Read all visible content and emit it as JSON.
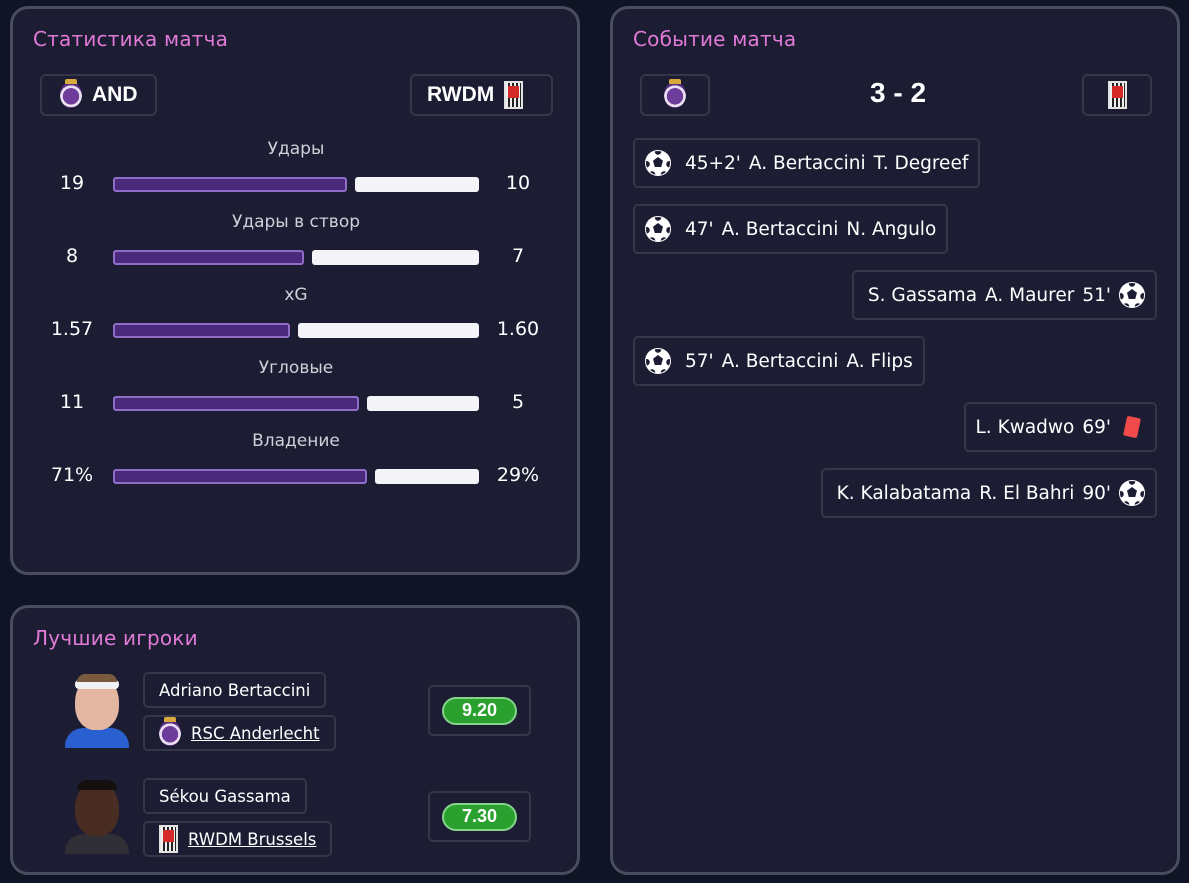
{
  "stats_panel": {
    "title": "Статистика матча",
    "home_team": "AND",
    "away_team": "RWDM",
    "stats": [
      {
        "label": "Удары",
        "home": "19",
        "away": "10",
        "home_share": 0.655
      },
      {
        "label": "Удары в створ",
        "home": "8",
        "away": "7",
        "home_share": 0.533
      },
      {
        "label": "xG",
        "home": "1.57",
        "away": "1.60",
        "home_share": 0.495
      },
      {
        "label": "Угловые",
        "home": "11",
        "away": "5",
        "home_share": 0.6875
      },
      {
        "label": "Владение",
        "home": "71%",
        "away": "29%",
        "home_share": 0.71
      }
    ]
  },
  "events_panel": {
    "title": "Событие матча",
    "score": "3 - 2",
    "events": [
      {
        "side": "home",
        "type": "goal",
        "minute": "45+2'",
        "player": "A. Bertaccini",
        "assist": "T. Degreef"
      },
      {
        "side": "home",
        "type": "goal",
        "minute": "47'",
        "player": "A. Bertaccini",
        "assist": "N. Angulo"
      },
      {
        "side": "away",
        "type": "goal",
        "minute": "51'",
        "player": "A. Maurer",
        "assist": "S. Gassama"
      },
      {
        "side": "home",
        "type": "goal",
        "minute": "57'",
        "player": "A. Bertaccini",
        "assist": "A. Flips"
      },
      {
        "side": "away",
        "type": "red-card",
        "minute": "69'",
        "player": "L. Kwadwo",
        "assist": ""
      },
      {
        "side": "away",
        "type": "goal",
        "minute": "90'",
        "player": "R. El Bahri",
        "assist": "K. Kalabatama"
      }
    ]
  },
  "players_panel": {
    "title": "Лучшие игроки",
    "players": [
      {
        "name": "Adriano Bertaccini",
        "club": "RSC Anderlecht",
        "rating": "9.20"
      },
      {
        "name": "Sékou Gassama",
        "club": "RWDM Brussels",
        "rating": "7.30"
      }
    ]
  },
  "colors": {
    "background": "#0f1524",
    "panel": "#1c1d33",
    "title_accent": "#e07ad6",
    "home_bar": "#4a2a7a",
    "away_bar": "#f4f4f8",
    "rating_green": "#2aa12e",
    "red_card": "#f04a4a"
  },
  "icons": {
    "goal": "soccer-ball-icon",
    "red_card": "red-card-icon",
    "home_logo": "anderlecht-logo-icon",
    "away_logo": "rwdm-logo-icon"
  }
}
